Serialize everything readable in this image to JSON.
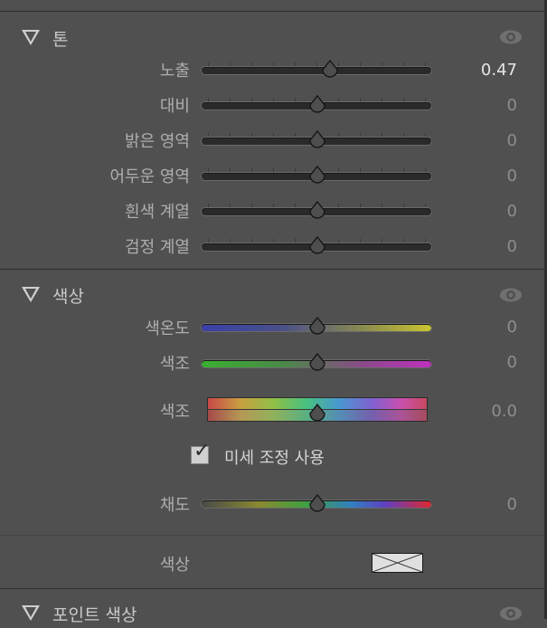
{
  "tone": {
    "title": "톤",
    "sliders": [
      {
        "label": "노출",
        "value": "0.47",
        "position": 0.56,
        "active": true
      },
      {
        "label": "대비",
        "value": "0",
        "position": 0.5
      },
      {
        "label": "밝은 영역",
        "value": "0",
        "position": 0.5
      },
      {
        "label": "어두운 영역",
        "value": "0",
        "position": 0.5
      },
      {
        "label": "흰색 계열",
        "value": "0",
        "position": 0.5
      },
      {
        "label": "검정 계열",
        "value": "0",
        "position": 0.5
      }
    ]
  },
  "color": {
    "title": "색상",
    "sliders": [
      {
        "label": "색온도",
        "value": "0",
        "position": 0.5
      },
      {
        "label": "색조",
        "value": "0",
        "position": 0.5
      }
    ],
    "hue": {
      "label": "색조",
      "value": "0.0",
      "position": 0.5
    },
    "fine_adjust": {
      "label": "미세 조정 사용",
      "checked": true,
      "mark": "✓"
    },
    "saturation": {
      "label": "채도",
      "value": "0",
      "position": 0.5
    },
    "swatch": {
      "label": "색상"
    }
  },
  "point_color": {
    "title": "포인트 색상"
  },
  "icons": {
    "section_toggle": "triangle-down-icon",
    "visibility": "eye-icon",
    "thumb": "slider-thumb-icon"
  },
  "colors": {
    "background": "#505050",
    "active_value": "#e6e6e6",
    "inactive_value": "#8e8e8e"
  }
}
